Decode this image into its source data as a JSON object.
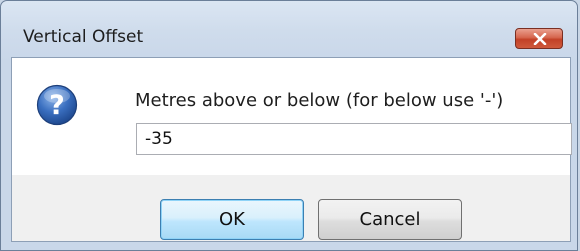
{
  "window": {
    "title": "Vertical Offset",
    "close_icon": "close-x-icon"
  },
  "dialog": {
    "icon": "question-icon",
    "prompt": "Metres above or below (for below use '-')",
    "input_value": "-35"
  },
  "buttons": {
    "ok_label": "OK",
    "cancel_label": "Cancel"
  },
  "colors": {
    "close_button": "#c9472c",
    "ok_button_border": "#3c7fb1",
    "icon_blue": "#2f5fae"
  }
}
